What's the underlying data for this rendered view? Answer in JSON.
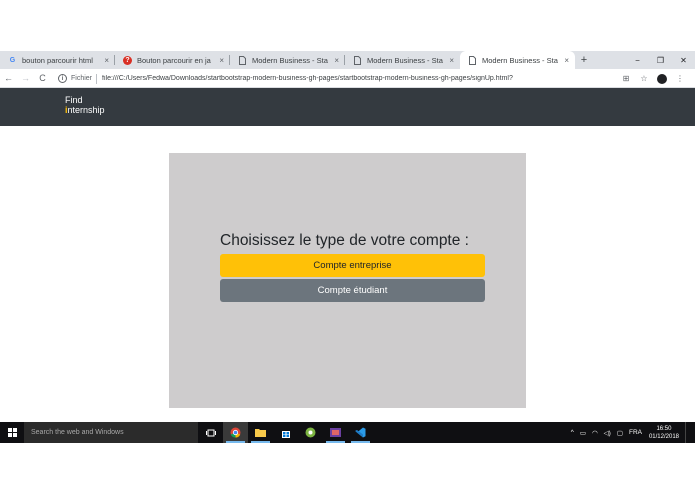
{
  "browser": {
    "tabs": [
      {
        "title": "bouton parcourir html",
        "favicon": "google-g-icon",
        "active": false
      },
      {
        "title": "Bouton parcourir en ja",
        "favicon": "question-icon",
        "active": false
      },
      {
        "title": "Modern Business - Sta",
        "favicon": "page-icon",
        "active": false
      },
      {
        "title": "Modern Business - Sta",
        "favicon": "page-icon",
        "active": false
      },
      {
        "title": "Modern Business - Sta",
        "favicon": "page-icon",
        "active": true
      }
    ],
    "tab_close": "×",
    "new_tab": "+",
    "window_controls": {
      "minimize": "−",
      "restore": "❐",
      "close": "✕"
    },
    "nav": {
      "back": "←",
      "forward": "→",
      "reload": "C"
    },
    "address": {
      "info": "i",
      "scheme_label": "Fichier",
      "url": "file:///C:/Users/Fedwa/Downloads/startbootstrap-modern-business-gh-pages/startbootstrap-modern-business-gh-pages/signUp.html?"
    },
    "toolbar_right": {
      "translate": "⊞",
      "star": "☆",
      "menu": "⋮"
    }
  },
  "site": {
    "logo_line1": "Find",
    "logo_line2": "nternship",
    "logo_i": "i",
    "heading": "Choisissez le type de votre compte :",
    "buttons": {
      "company": "Compte entreprise",
      "student": "Compte étudiant"
    }
  },
  "taskbar": {
    "search_placeholder": "Search the web and Windows",
    "tray": {
      "chevron": "^",
      "lang": "FRA",
      "time": "16:50",
      "date": "01/12/2018"
    }
  },
  "colors": {
    "navbar": "#343a40",
    "accent": "#ffc107",
    "secondary": "#6c757d",
    "card": "#cecccd"
  }
}
